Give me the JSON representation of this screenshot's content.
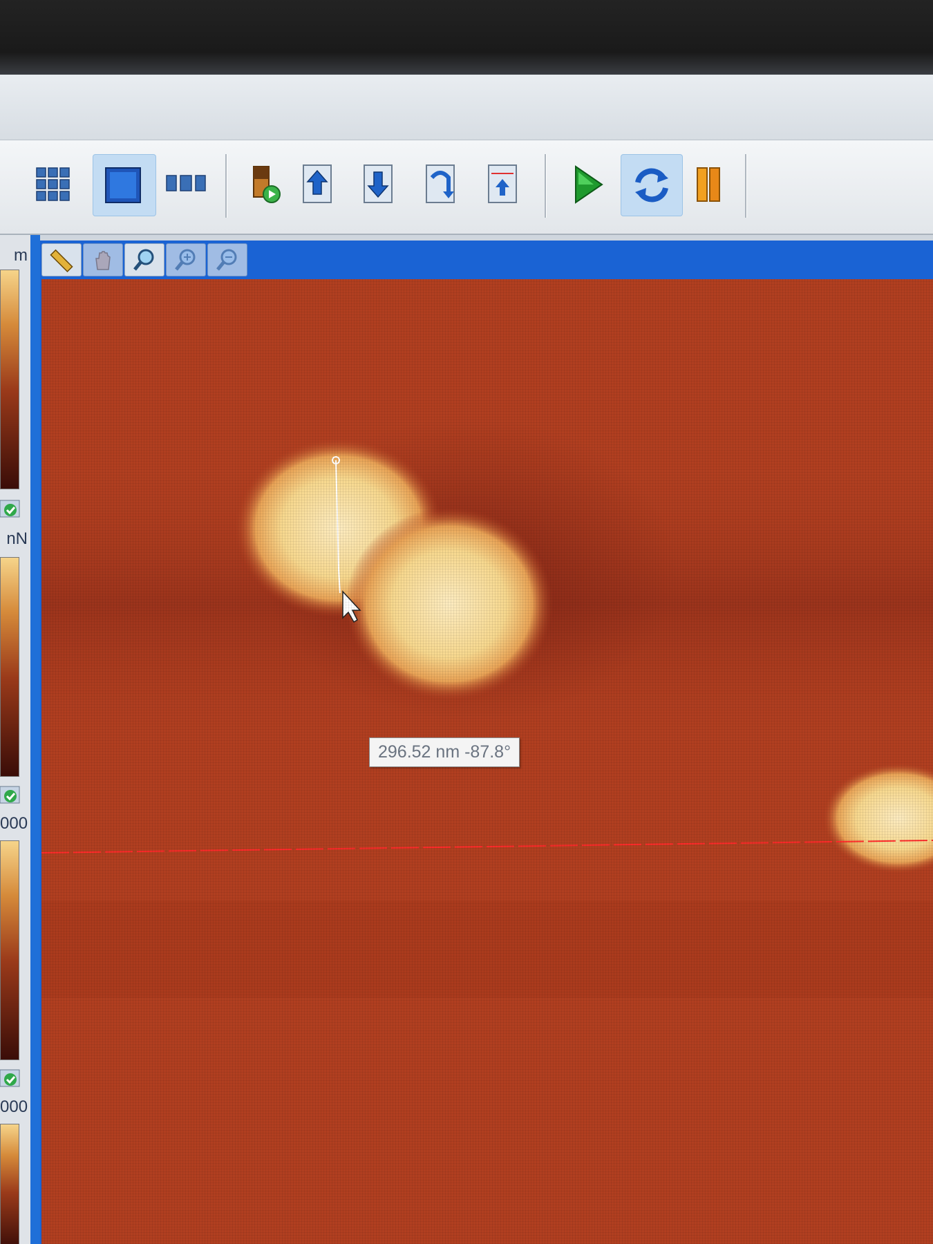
{
  "toolbar": {
    "buttons": [
      {
        "icon": "grid-view-icon",
        "active": false
      },
      {
        "icon": "single-view-icon",
        "active": true
      },
      {
        "icon": "strip-view-icon",
        "active": false
      },
      {
        "icon": "load-image-icon",
        "active": false
      },
      {
        "icon": "scan-up-icon",
        "active": false
      },
      {
        "icon": "scan-down-icon",
        "active": false
      },
      {
        "icon": "rotate-scan-icon",
        "active": false
      },
      {
        "icon": "withdraw-icon",
        "active": false
      },
      {
        "icon": "play-icon",
        "active": false
      },
      {
        "icon": "refresh-icon",
        "active": true
      },
      {
        "icon": "pause-icon",
        "active": false
      }
    ]
  },
  "left_panel": {
    "labels": [
      "m",
      "nN",
      "000",
      "000"
    ]
  },
  "image_tools": [
    "ruler-icon",
    "hand-pan-icon",
    "magnifier-icon",
    "zoom-in-icon",
    "zoom-out-icon"
  ],
  "measurement": {
    "tooltip": "296.52 nm -87.8°"
  },
  "colors": {
    "accent": "#1a63d4",
    "afm_background": "#b13f20",
    "afm_highlight": "#fbe2a4",
    "scan_line": "#ff2a2a"
  }
}
